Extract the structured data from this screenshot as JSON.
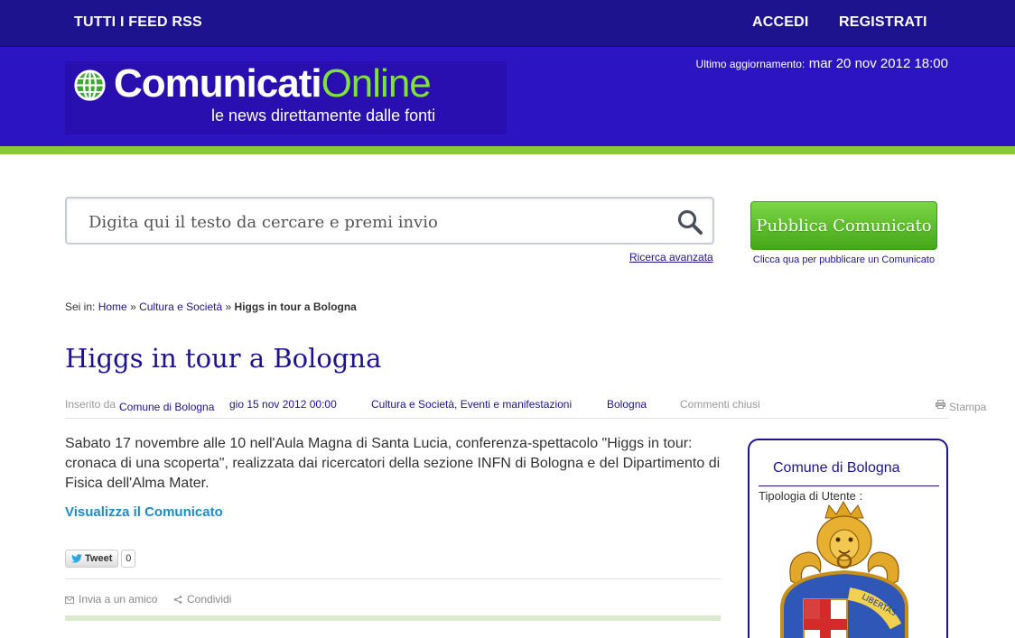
{
  "topbar": {
    "rss_label": "TUTTI I FEED RSS",
    "login_label": "ACCEDI",
    "register_label": "REGISTRATI"
  },
  "header": {
    "logo_part1": "Comunicati",
    "logo_part2": "Online",
    "tagline": "le news direttamente dalle fonti",
    "updated_label": "Ultimo aggiornamento:",
    "updated_value": "mar 20 nov 2012 18:00"
  },
  "search": {
    "placeholder": "Digita qui il testo da cercare e premi invio",
    "advanced_label": "Ricerca avanzata"
  },
  "publish": {
    "button_label": "Pubblica Comunicato",
    "note": "Clicca qua per pubblicare un Comunicato"
  },
  "breadcrumb": {
    "prefix": "Sei in:",
    "home": "Home",
    "sep1": "»",
    "category": "Cultura e Società",
    "sep2": "»",
    "current": "Higgs in tour a Bologna"
  },
  "article": {
    "title": "Higgs in tour a Bologna",
    "inserted_by_label": "Inserito da",
    "author": "Comune di Bologna",
    "date": "gio 15 nov 2012 00:00",
    "categories": "Cultura e Società, Eventi e manifestazioni",
    "city": "Bologna",
    "comments": "Commenti chiusi",
    "print_label": "Stampa",
    "summary": "Sabato 17 novembre alle 10 nell'Aula Magna di Santa Lucia, conferenza-spettacolo \"Higgs in tour: cronaca di una scoperta\", realizzata dai ricercatori della sezione INFN di Bologna e del Dipartimento di Fisica dell'Alma Mater.",
    "view_link": "Visualizza il Comunicato",
    "tweet_label": "Tweet",
    "tweet_count": "0",
    "send_friend": "Invia a un amico",
    "share": "Condividi"
  },
  "sidebox": {
    "name": "Comune di Bologna",
    "user_type_label": "Tipologia di Utente :",
    "crest_text": "LIBERTAS"
  },
  "colors": {
    "navy": "#1e138f",
    "header_blue": "#2d14c2",
    "green": "#89c83a",
    "link_blue": "#1a8dc4"
  }
}
